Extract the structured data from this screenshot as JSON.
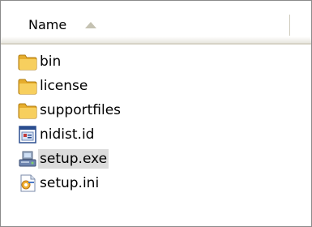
{
  "header": {
    "column_name": "Name",
    "sort": "ascending"
  },
  "files": [
    {
      "name": "bin",
      "icon": "folder-icon",
      "kind": "folder"
    },
    {
      "name": "license",
      "icon": "folder-icon",
      "kind": "folder"
    },
    {
      "name": "supportfiles",
      "icon": "folder-icon",
      "kind": "folder"
    },
    {
      "name": "nidist.id",
      "icon": "id-file-icon",
      "kind": "file"
    },
    {
      "name": "setup.exe",
      "icon": "installer-icon",
      "kind": "file",
      "selected": true
    },
    {
      "name": "setup.ini",
      "icon": "settings-file-icon",
      "kind": "file"
    }
  ],
  "colors": {
    "folder": "#f2c04a",
    "selection": "#dcdcdc",
    "border": "#8a8a8a"
  }
}
